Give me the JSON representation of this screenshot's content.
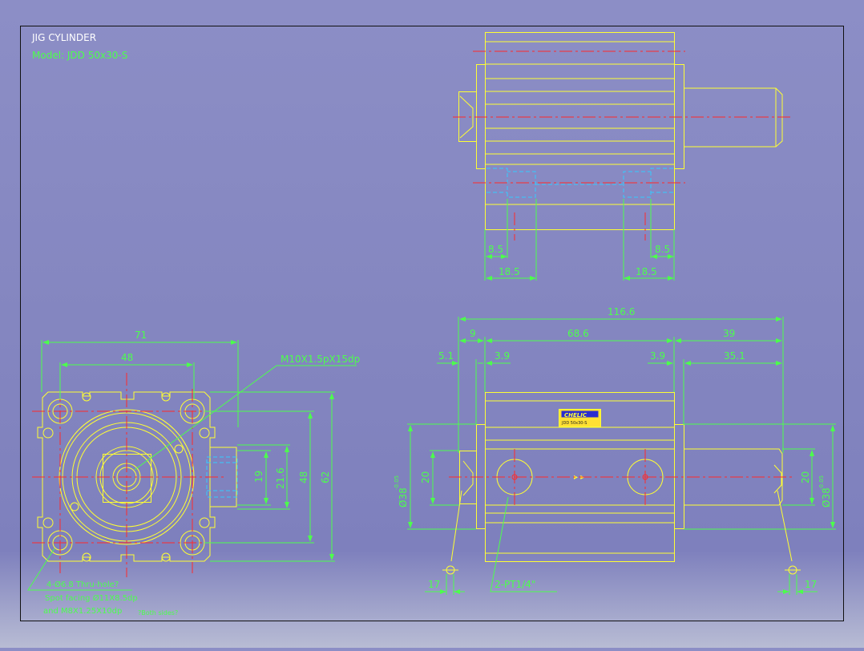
{
  "title": "JIG CYLINDER",
  "model": "Model: JDD 50x30-S",
  "colors": {
    "background": "#8486c0",
    "object_lines": "#ffff33",
    "dimensions": "#4cff4c",
    "center_lines": "#ff2a2a",
    "hidden_lines": "#33ccff",
    "title_text": "#ffffff"
  },
  "top_view": {
    "dims": {
      "d85_left": "8.5",
      "d185_left": "18.5",
      "d85_right": "8.5",
      "d185_right": "18.5"
    }
  },
  "end_view": {
    "dims": {
      "width_71": "71",
      "width_48": "48",
      "h19": "19",
      "h216": "21.6",
      "h48": "48",
      "h62": "62"
    },
    "thread_note": "M10X1.5pX15dp",
    "hole_note_1": "4-Ø6.8 Thru-hole?",
    "hole_note_2": "Spot facing Ø11X8.5dp",
    "hole_note_3": "and M8X1.25X10dp",
    "hole_note_4": "?Both sides?"
  },
  "front_view": {
    "dims": {
      "total": "116.6",
      "d9": "9",
      "d686": "68.6",
      "d39": "39",
      "d51": "5.1",
      "d39a": "3.9",
      "d39b": "3.9",
      "d351": "35.1",
      "dia_left": "Ø38",
      "tol_left": "-0.05",
      "h20_left": "20",
      "h20_right": "20",
      "dia_right": "Ø38",
      "tol_right": "-0.05",
      "d17_left": "17",
      "d17_right": "17"
    },
    "port_note": "2-PT1/4\"",
    "label_brand": "CHELIC",
    "label_line": "JDD 50x30-S"
  }
}
